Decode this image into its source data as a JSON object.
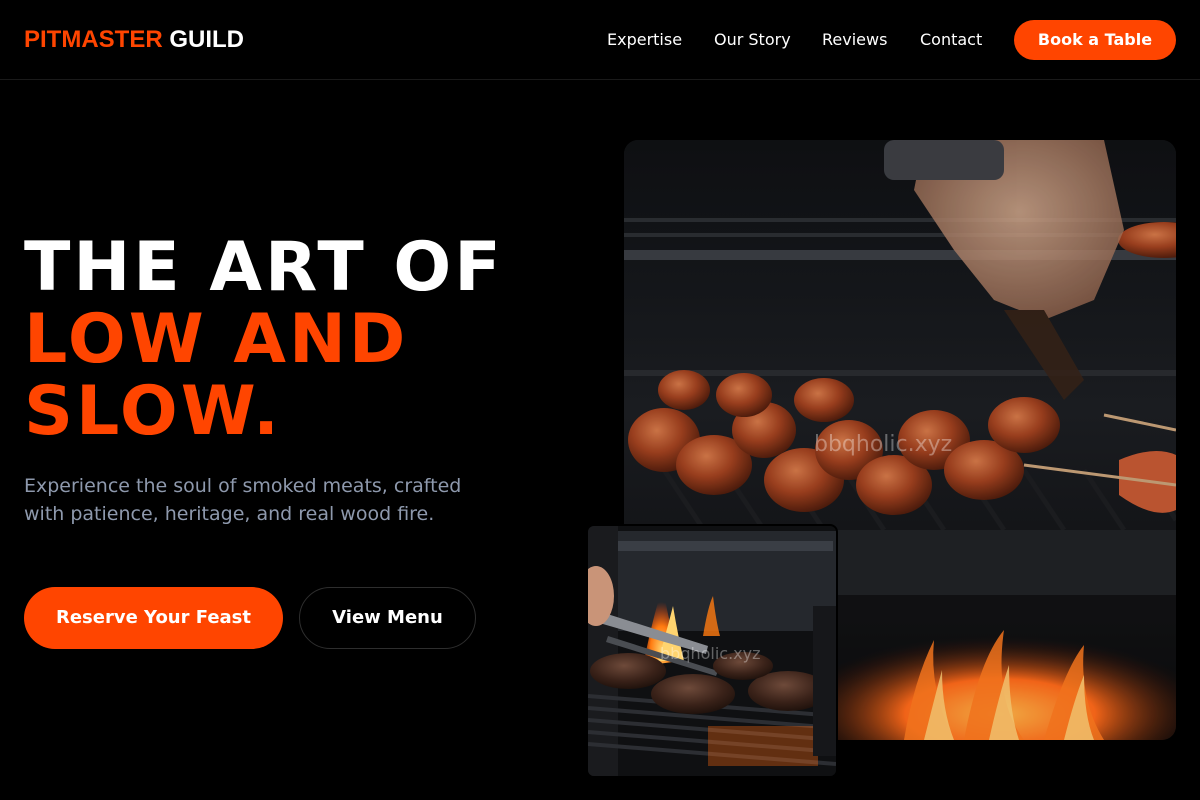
{
  "brand": {
    "accent_text": "PITMASTER",
    "plain_text": "GUILD",
    "accent_color": "#ff4500"
  },
  "nav": {
    "links": [
      "Expertise",
      "Our Story",
      "Reviews",
      "Contact"
    ],
    "cta_label": "Book a Table"
  },
  "hero": {
    "headline_line1": "THE ART OF",
    "headline_line2": "LOW AND",
    "headline_line3": "SLOW.",
    "subtext": "Experience the soul of smoked meats, crafted with patience, heritage, and real wood fire.",
    "primary_cta": "Reserve Your Feast",
    "secondary_cta": "View Menu"
  },
  "images": {
    "main_watermark": "bbqholic.xyz",
    "small_watermark": "bbqholic.xyz"
  },
  "colors": {
    "background": "#000000",
    "accent": "#ff4500",
    "muted_text": "#8e99ad"
  }
}
